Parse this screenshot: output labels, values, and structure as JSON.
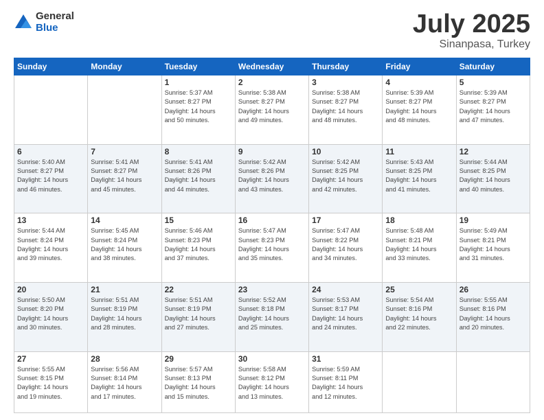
{
  "logo": {
    "general": "General",
    "blue": "Blue"
  },
  "title": {
    "month": "July 2025",
    "location": "Sinanpasa, Turkey"
  },
  "weekdays": [
    "Sunday",
    "Monday",
    "Tuesday",
    "Wednesday",
    "Thursday",
    "Friday",
    "Saturday"
  ],
  "weeks": [
    [
      {
        "day": "",
        "info": ""
      },
      {
        "day": "",
        "info": ""
      },
      {
        "day": "1",
        "info": "Sunrise: 5:37 AM\nSunset: 8:27 PM\nDaylight: 14 hours\nand 50 minutes."
      },
      {
        "day": "2",
        "info": "Sunrise: 5:38 AM\nSunset: 8:27 PM\nDaylight: 14 hours\nand 49 minutes."
      },
      {
        "day": "3",
        "info": "Sunrise: 5:38 AM\nSunset: 8:27 PM\nDaylight: 14 hours\nand 48 minutes."
      },
      {
        "day": "4",
        "info": "Sunrise: 5:39 AM\nSunset: 8:27 PM\nDaylight: 14 hours\nand 48 minutes."
      },
      {
        "day": "5",
        "info": "Sunrise: 5:39 AM\nSunset: 8:27 PM\nDaylight: 14 hours\nand 47 minutes."
      }
    ],
    [
      {
        "day": "6",
        "info": "Sunrise: 5:40 AM\nSunset: 8:27 PM\nDaylight: 14 hours\nand 46 minutes."
      },
      {
        "day": "7",
        "info": "Sunrise: 5:41 AM\nSunset: 8:27 PM\nDaylight: 14 hours\nand 45 minutes."
      },
      {
        "day": "8",
        "info": "Sunrise: 5:41 AM\nSunset: 8:26 PM\nDaylight: 14 hours\nand 44 minutes."
      },
      {
        "day": "9",
        "info": "Sunrise: 5:42 AM\nSunset: 8:26 PM\nDaylight: 14 hours\nand 43 minutes."
      },
      {
        "day": "10",
        "info": "Sunrise: 5:42 AM\nSunset: 8:25 PM\nDaylight: 14 hours\nand 42 minutes."
      },
      {
        "day": "11",
        "info": "Sunrise: 5:43 AM\nSunset: 8:25 PM\nDaylight: 14 hours\nand 41 minutes."
      },
      {
        "day": "12",
        "info": "Sunrise: 5:44 AM\nSunset: 8:25 PM\nDaylight: 14 hours\nand 40 minutes."
      }
    ],
    [
      {
        "day": "13",
        "info": "Sunrise: 5:44 AM\nSunset: 8:24 PM\nDaylight: 14 hours\nand 39 minutes."
      },
      {
        "day": "14",
        "info": "Sunrise: 5:45 AM\nSunset: 8:24 PM\nDaylight: 14 hours\nand 38 minutes."
      },
      {
        "day": "15",
        "info": "Sunrise: 5:46 AM\nSunset: 8:23 PM\nDaylight: 14 hours\nand 37 minutes."
      },
      {
        "day": "16",
        "info": "Sunrise: 5:47 AM\nSunset: 8:23 PM\nDaylight: 14 hours\nand 35 minutes."
      },
      {
        "day": "17",
        "info": "Sunrise: 5:47 AM\nSunset: 8:22 PM\nDaylight: 14 hours\nand 34 minutes."
      },
      {
        "day": "18",
        "info": "Sunrise: 5:48 AM\nSunset: 8:21 PM\nDaylight: 14 hours\nand 33 minutes."
      },
      {
        "day": "19",
        "info": "Sunrise: 5:49 AM\nSunset: 8:21 PM\nDaylight: 14 hours\nand 31 minutes."
      }
    ],
    [
      {
        "day": "20",
        "info": "Sunrise: 5:50 AM\nSunset: 8:20 PM\nDaylight: 14 hours\nand 30 minutes."
      },
      {
        "day": "21",
        "info": "Sunrise: 5:51 AM\nSunset: 8:19 PM\nDaylight: 14 hours\nand 28 minutes."
      },
      {
        "day": "22",
        "info": "Sunrise: 5:51 AM\nSunset: 8:19 PM\nDaylight: 14 hours\nand 27 minutes."
      },
      {
        "day": "23",
        "info": "Sunrise: 5:52 AM\nSunset: 8:18 PM\nDaylight: 14 hours\nand 25 minutes."
      },
      {
        "day": "24",
        "info": "Sunrise: 5:53 AM\nSunset: 8:17 PM\nDaylight: 14 hours\nand 24 minutes."
      },
      {
        "day": "25",
        "info": "Sunrise: 5:54 AM\nSunset: 8:16 PM\nDaylight: 14 hours\nand 22 minutes."
      },
      {
        "day": "26",
        "info": "Sunrise: 5:55 AM\nSunset: 8:16 PM\nDaylight: 14 hours\nand 20 minutes."
      }
    ],
    [
      {
        "day": "27",
        "info": "Sunrise: 5:55 AM\nSunset: 8:15 PM\nDaylight: 14 hours\nand 19 minutes."
      },
      {
        "day": "28",
        "info": "Sunrise: 5:56 AM\nSunset: 8:14 PM\nDaylight: 14 hours\nand 17 minutes."
      },
      {
        "day": "29",
        "info": "Sunrise: 5:57 AM\nSunset: 8:13 PM\nDaylight: 14 hours\nand 15 minutes."
      },
      {
        "day": "30",
        "info": "Sunrise: 5:58 AM\nSunset: 8:12 PM\nDaylight: 14 hours\nand 13 minutes."
      },
      {
        "day": "31",
        "info": "Sunrise: 5:59 AM\nSunset: 8:11 PM\nDaylight: 14 hours\nand 12 minutes."
      },
      {
        "day": "",
        "info": ""
      },
      {
        "day": "",
        "info": ""
      }
    ]
  ]
}
